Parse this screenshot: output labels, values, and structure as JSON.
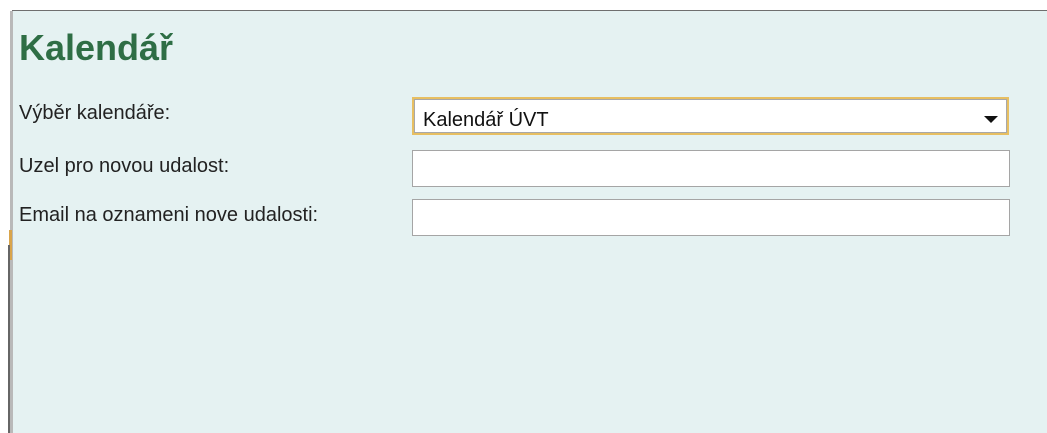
{
  "page": {
    "title": "Kalendář"
  },
  "form": {
    "calendar_select_label": "Výběr kalendáře:",
    "calendar_select_value": "Kalendář ÚVT",
    "node_label": "Uzel pro novou udalost:",
    "node_value": "",
    "email_label": "Email na oznameni nove udalosti:",
    "email_value": ""
  },
  "icons": {
    "dropdown": "chevron-down-icon"
  },
  "colors": {
    "title": "#2e6e45",
    "panel_background": "#e5f2f2",
    "select_focus_border": "#e7bf62",
    "input_border": "#a5a5a5"
  }
}
